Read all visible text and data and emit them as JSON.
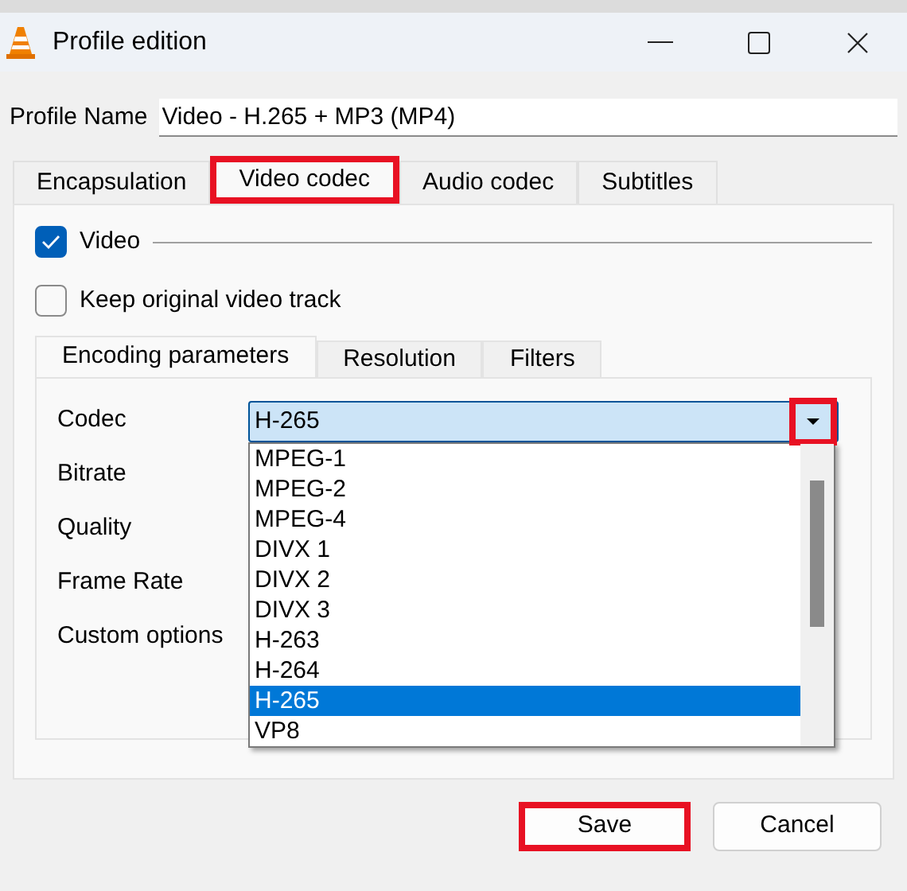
{
  "window": {
    "title": "Profile edition"
  },
  "profile_name": {
    "label": "Profile Name",
    "value": "Video - H.265 + MP3 (MP4)"
  },
  "tabs": [
    {
      "label": "Encapsulation",
      "selected": false,
      "highlighted": false
    },
    {
      "label": "Video codec",
      "selected": true,
      "highlighted": true
    },
    {
      "label": "Audio codec",
      "selected": false,
      "highlighted": false
    },
    {
      "label": "Subtitles",
      "selected": false,
      "highlighted": false
    }
  ],
  "video": {
    "label": "Video",
    "checked": true
  },
  "keep_original": {
    "label": "Keep original video track",
    "checked": false
  },
  "inner_tabs": [
    {
      "label": "Encoding parameters",
      "selected": true
    },
    {
      "label": "Resolution",
      "selected": false
    },
    {
      "label": "Filters",
      "selected": false
    }
  ],
  "fields": [
    {
      "label": "Codec"
    },
    {
      "label": "Bitrate"
    },
    {
      "label": "Quality"
    },
    {
      "label": "Frame Rate"
    },
    {
      "label": "Custom options"
    }
  ],
  "codec_combo": {
    "value": "H-265",
    "arrow_highlighted": true,
    "expanded": true
  },
  "codec_options": [
    {
      "label": "MPEG-1",
      "selected": false
    },
    {
      "label": "MPEG-2",
      "selected": false
    },
    {
      "label": "MPEG-4",
      "selected": false
    },
    {
      "label": "DIVX 1",
      "selected": false
    },
    {
      "label": "DIVX 2",
      "selected": false
    },
    {
      "label": "DIVX 3",
      "selected": false
    },
    {
      "label": "H-263",
      "selected": false
    },
    {
      "label": "H-264",
      "selected": false
    },
    {
      "label": "H-265",
      "selected": true
    },
    {
      "label": "VP8",
      "selected": false
    }
  ],
  "buttons": [
    {
      "label": "Save",
      "highlighted": true
    },
    {
      "label": "Cancel",
      "highlighted": false
    }
  ]
}
